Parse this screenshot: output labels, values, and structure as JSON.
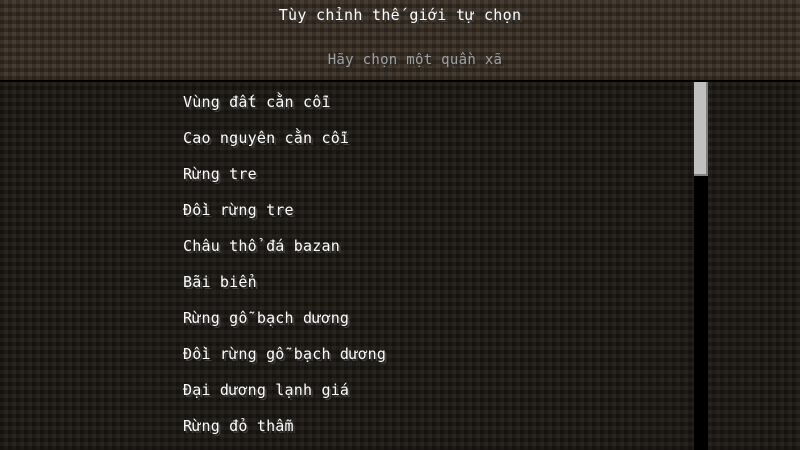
{
  "header": {
    "title": "Tùy chỉnh thế giới tự chọn",
    "subtitle": "Hãy chọn một quần xã"
  },
  "biomes": [
    "Vùng đất cằn cỗi",
    "Cao nguyên cằn cỗi",
    "Rừng tre",
    "Đồi rừng tre",
    "Châu thổ đá bazan",
    "Bãi biển",
    "Rừng gỗ bạch dương",
    "Đồi rừng gỗ bạch dương",
    "Đại dương lạnh giá",
    "Rừng đỏ thẫm"
  ],
  "colors": {
    "text": "#ffffff",
    "subtitle": "#a0a0a0",
    "header_bg": "#3b3126",
    "list_bg": "#1f1b16",
    "scroll_track": "#000000",
    "scroll_thumb": "#c0c0c0"
  }
}
